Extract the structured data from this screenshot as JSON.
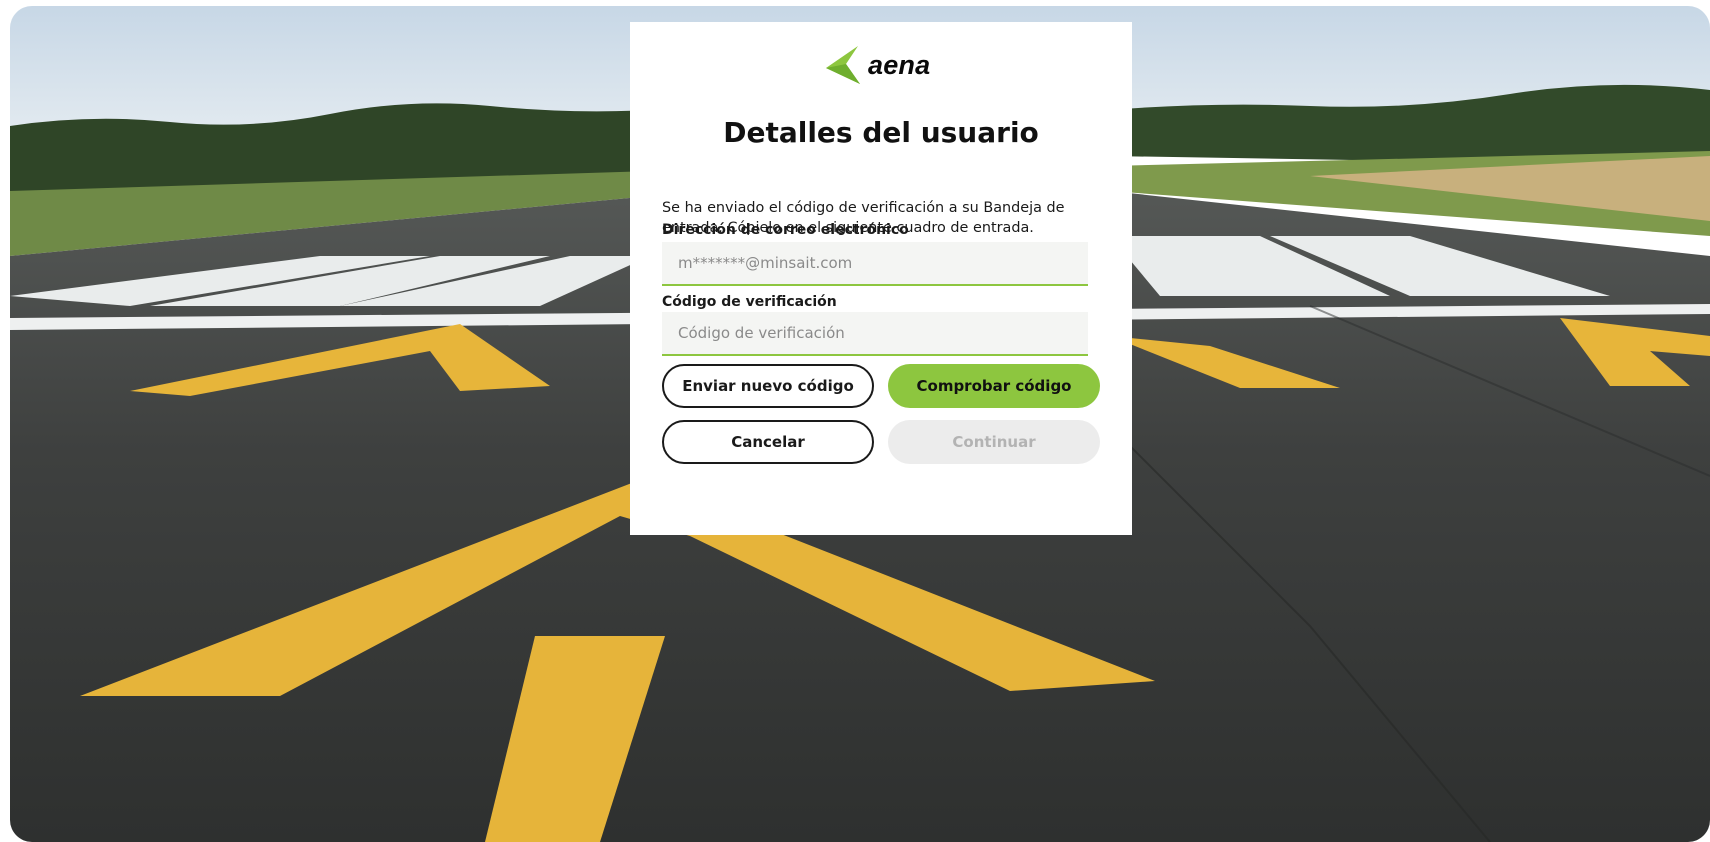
{
  "brand": {
    "name": "aena",
    "accent_color": "#8dc63f",
    "logo_icon": "aena-logo-icon"
  },
  "form": {
    "title": "Detalles del usuario",
    "info_text": "Se ha enviado el código de verificación a su Bandeja de entrada. Cópielo en el siguiente cuadro de entrada.",
    "email_label": "Dirección de correo electrónico",
    "email_value": "m*******@minsait.com",
    "code_label": "Código de verificación",
    "code_placeholder": "Código de verificación",
    "code_value": ""
  },
  "buttons": {
    "send_new_code": "Enviar nuevo código",
    "verify_code": "Comprobar código",
    "cancel": "Cancelar",
    "continue": "Continuar"
  },
  "background": {
    "description_icon": "runway-background-image"
  }
}
